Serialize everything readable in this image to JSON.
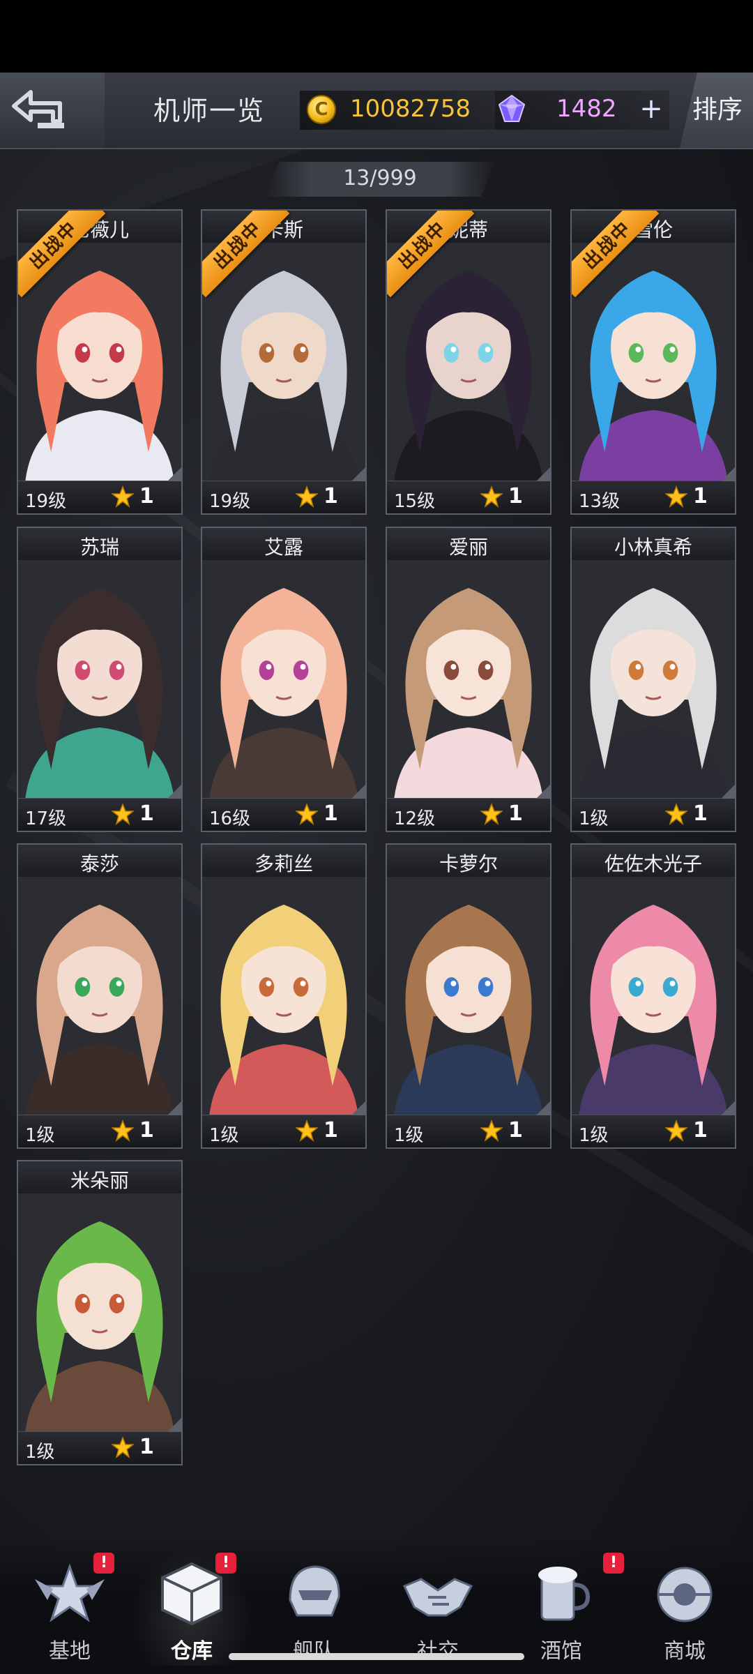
{
  "header": {
    "title": "机师一览",
    "gold_amount": "10082758",
    "gold_icon_glyph": "C",
    "gem_amount": "1482",
    "add_label": "+",
    "sort_label": "排序"
  },
  "pilot_count": "13/999",
  "cards": [
    {
      "name": "尼薇儿",
      "level": "19级",
      "stars": "1",
      "deployed": true
    },
    {
      "name": "卡斯",
      "level": "19级",
      "stars": "1",
      "deployed": true
    },
    {
      "name": "妮蒂",
      "level": "15级",
      "stars": "1",
      "deployed": true
    },
    {
      "name": "雪伦",
      "level": "13级",
      "stars": "1",
      "deployed": true
    },
    {
      "name": "苏瑞",
      "level": "17级",
      "stars": "1",
      "deployed": false
    },
    {
      "name": "艾露",
      "level": "16级",
      "stars": "1",
      "deployed": false
    },
    {
      "name": "爱丽",
      "level": "12级",
      "stars": "1",
      "deployed": false
    },
    {
      "name": "小林真希",
      "level": "1级",
      "stars": "1",
      "deployed": false
    },
    {
      "name": "泰莎",
      "level": "1级",
      "stars": "1",
      "deployed": false
    },
    {
      "name": "多莉丝",
      "level": "1级",
      "stars": "1",
      "deployed": false
    },
    {
      "name": "卡萝尔",
      "level": "1级",
      "stars": "1",
      "deployed": false
    },
    {
      "name": "佐佐木光子",
      "level": "1级",
      "stars": "1",
      "deployed": false
    },
    {
      "name": "米朵丽",
      "level": "1级",
      "stars": "1",
      "deployed": false
    }
  ],
  "deploy_tag": "出战中",
  "nav": {
    "base": "基地",
    "warehouse": "仓库",
    "hangar": "舰队",
    "social": "社交",
    "tavern": "酒馆",
    "shop": "商城",
    "alert_glyph": "!"
  },
  "colors": {
    "gold": "#f5c43a",
    "gem": "#f0a6ff",
    "deploy_ribbon": "#ffb640",
    "alert": "#e5203a"
  }
}
